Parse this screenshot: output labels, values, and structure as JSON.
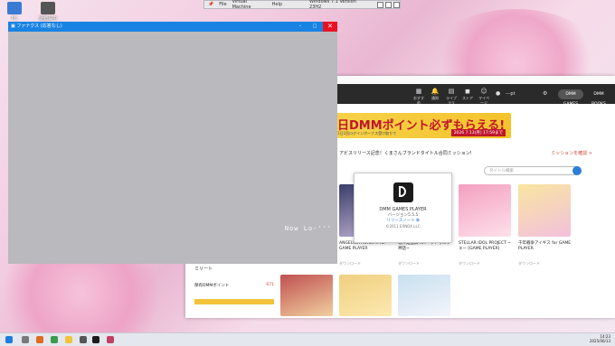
{
  "desktop": {
    "icons": [
      {
        "label": "PC",
        "icon": "computer-icon"
      },
      {
        "label": "運動会中",
        "icon": "app-icon"
      }
    ]
  },
  "vm_bar": {
    "menu": [
      "File",
      "Virtual Machine",
      "Help"
    ],
    "title": "Windows 7.1 Version 23H2"
  },
  "loading_window": {
    "title": "ファナクス (応答なし)",
    "loading_text": "Now Lo-'''"
  },
  "dmm": {
    "nav": [
      {
        "label": "おすすめ"
      },
      {
        "label": "通知"
      },
      {
        "label": "ライブラリ"
      },
      {
        "label": "ストア"
      },
      {
        "label": "マイページ"
      }
    ],
    "user": "---pt",
    "mode_buttons": [
      "DMM GAMES",
      "DMM BOOKS"
    ],
    "banner": {
      "title": "日DMMポイント必ずもらえる!",
      "subtitle": "1日1回ログインボーナス受け取りで",
      "date": "2026 7.13(月) 17:59まで"
    },
    "notice": "アビスリリース記念！くまさんブランドタイトル合同ミッション!",
    "notice_link": "ミッションを確認 >",
    "search_placeholder": "タイトル検索",
    "side": {
      "label": "ミリート",
      "point_label": "保有DMMポイント",
      "point_value": "671"
    },
    "games": [
      {
        "name": "ANGELICA ASTER R for GAME PLAYER",
        "dev": "ダウンロード"
      },
      {
        "name": "戦神姫乱舞 HA ~クトゥルフ神話~",
        "dev": "ダウンロード"
      },
      {
        "name": "STELLAR IDOL PROJECT ~ エー [GAME PLAYER]",
        "dev": "ダウンロード"
      },
      {
        "name": "千年戦争アイギス for GAME PLAYER",
        "dev": "ダウンロード"
      }
    ]
  },
  "about_dialog": {
    "close": "×",
    "name": "DMM GAMES PLAYER",
    "version": "バージョン5.5.5",
    "release_notes": "リリースノート",
    "copyright": "©2011 EXNOA LLC"
  },
  "taskbar": {
    "time": "14:23",
    "date": "2025/06/13"
  },
  "colors": {
    "title_blue": "#1983e3",
    "close_red": "#e81123",
    "banner_yellow": "#f6d24a",
    "dmm_nav": "#2a2a2a"
  }
}
